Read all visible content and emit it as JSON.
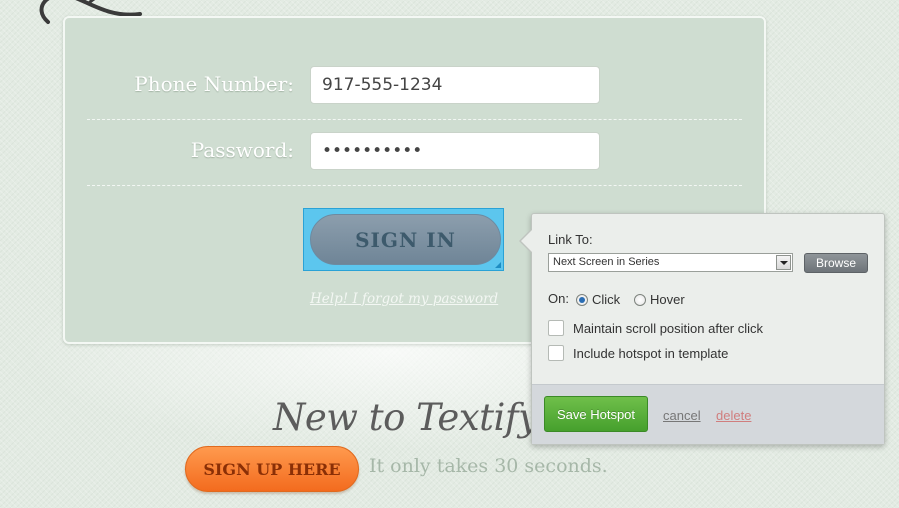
{
  "login": {
    "phone_label": "Phone Number:",
    "phone_value": "917-555-1234",
    "password_label": "Password:",
    "password_value": "••••••••••",
    "signin_label": "SIGN IN",
    "forgot_link": "Help! I forgot my password"
  },
  "signup": {
    "heading": "New to Textify",
    "button_label": "SIGN UP HERE",
    "note": "It only takes 30 seconds."
  },
  "hotspot_popover": {
    "link_to_label": "Link To:",
    "link_to_selected": "Next Screen in Series",
    "browse_label": "Browse",
    "on_label": "On:",
    "trigger_options": [
      {
        "label": "Click",
        "selected": true
      },
      {
        "label": "Hover",
        "selected": false
      }
    ],
    "options": [
      {
        "label": "Maintain scroll position after click",
        "checked": false
      },
      {
        "label": "Include hotspot in template",
        "checked": false
      }
    ],
    "save_label": "Save Hotspot",
    "cancel_label": "cancel",
    "delete_label": "delete"
  },
  "colors": {
    "hotspot_highlight": "#5cc6ee",
    "save_button": "#46a02d",
    "signup_button": "#f36b1e",
    "delete_link": "#d07e7e"
  }
}
